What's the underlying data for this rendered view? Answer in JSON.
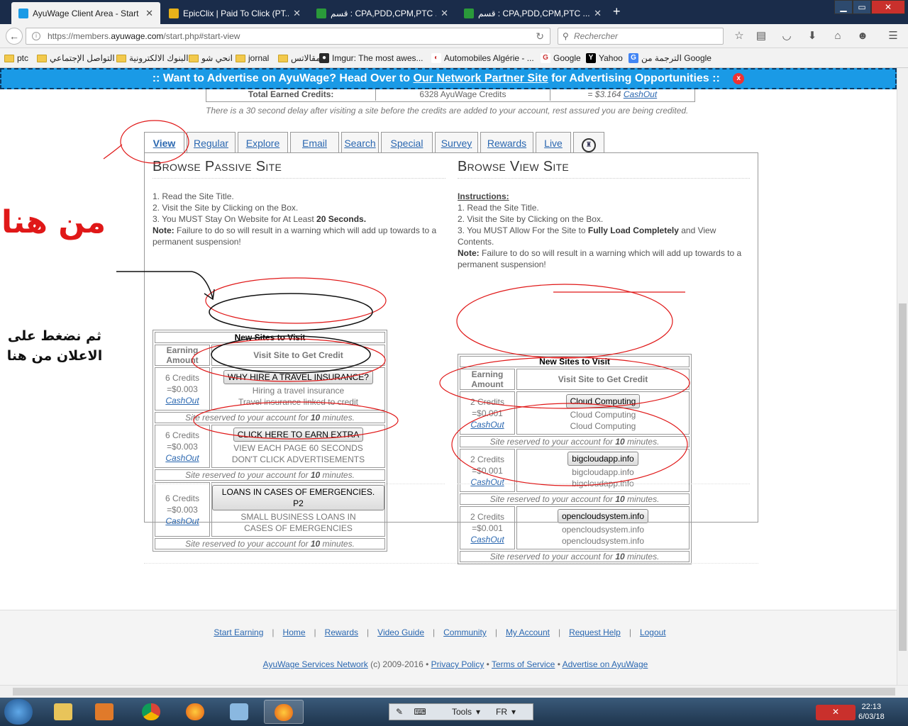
{
  "browser": {
    "tabs": [
      {
        "title": "AyuWage Client Area - Start Ea...",
        "active": true,
        "favicon_color": "#1a9ae6"
      },
      {
        "title": "EpicClix | Paid To Click (PT...",
        "active": false,
        "favicon_color": "#e8b21a"
      },
      {
        "title": "قسم : CPA,PDD,CPM,PTC ....",
        "active": false,
        "favicon_color": "#2a9a3a"
      },
      {
        "title": "قسم : CPA,PDD,CPM,PTC ....",
        "active": false,
        "favicon_color": "#2a9a3a"
      }
    ],
    "new_tab": "+",
    "url_prefix": "https://members.",
    "url_domain": "ayuwage.com",
    "url_path": "/start.php#start-view",
    "search_placeholder": "Rechercher",
    "bookmarks": [
      {
        "label": "ptc",
        "type": "folder"
      },
      {
        "label": "التواصل الإجتماعي",
        "type": "folder"
      },
      {
        "label": "البنوك الالكترونية",
        "type": "folder"
      },
      {
        "label": "انحي شو",
        "type": "folder"
      },
      {
        "label": "jornal",
        "type": "folder"
      },
      {
        "label": "مقالاتس",
        "type": "folder"
      },
      {
        "label": "Imgur: The most awes...",
        "type": "site",
        "color": "#2a2a2a",
        "glyph": "●"
      },
      {
        "label": "Automobiles Algérie - ...",
        "type": "site",
        "color": "#ffffff",
        "glyph": "◐"
      },
      {
        "label": "Google",
        "type": "site",
        "color": "#ffffff",
        "glyph": "G"
      },
      {
        "label": "Yahoo",
        "type": "site",
        "color": "#000000",
        "glyph": "Y"
      },
      {
        "label": "الترجمة من Google",
        "type": "site",
        "color": "#4285f4",
        "glyph": "G"
      }
    ]
  },
  "ad_banner": {
    "before": ":: Want to Advertise on AyuWage? Head Over to ",
    "link": "Our Network Partner Site",
    "after": " for Advertising Opportunities ::",
    "close": "x"
  },
  "credits_row": {
    "label": "Total Earned Credits:",
    "credits": "6328 AyuWage Credits",
    "value_prefix": "= $3.164 ",
    "cashout": "CashOut"
  },
  "delay_note": "There is a 30 second delay after visiting a site before the credits are added to your account, rest assured you are being credited.",
  "tabs": [
    "View",
    "Regular",
    "Explore",
    "Email",
    "Search",
    "Special",
    "Survey",
    "Rewards",
    "Live"
  ],
  "trophy_tab": "♜",
  "passive": {
    "title": "Browse Passive Site",
    "steps": [
      "1. Read the Site Title.",
      "2. Visit the Site by Clicking on the Box.",
      "3. You MUST Stay On Website for At Least "
    ],
    "step3_bold": "20 Seconds.",
    "note_label": "Note:",
    "note_text": " Failure to do so will result in a warning which will add up towards to a permanent suspension!",
    "table_title": "New Sites to Visit",
    "col_earning": "Earning Amount",
    "col_visit": "Visit Site to Get Credit",
    "rows": [
      {
        "credits": "6 Credits",
        "value": "=$0.003",
        "cashout": "CashOut",
        "button": "WHY HIRE A TRAVEL INSURANCE?",
        "line1": "Hiring a travel insurance",
        "line2": "Travel insurance linked to credit",
        "reserved_pre": "Site reserved to your account for ",
        "reserved_min": "10",
        "reserved_post": " minutes."
      },
      {
        "credits": "6 Credits",
        "value": "=$0.003",
        "cashout": "CashOut",
        "button": "CLICK HERE TO EARN EXTRA",
        "line1": "VIEW EACH PAGE 60 SECONDS",
        "line2": "DON'T CLICK ADVERTISEMENTS",
        "reserved_pre": "Site reserved to your account for ",
        "reserved_min": "10",
        "reserved_post": " minutes."
      },
      {
        "credits": "6 Credits",
        "value": "=$0.003",
        "cashout": "CashOut",
        "button": "LOANS IN CASES OF EMERGENCIES. P2",
        "line1": "SMALL BUSINESS LOANS IN",
        "line2": "CASES OF EMERGENCIES",
        "reserved_pre": "Site reserved to your account for ",
        "reserved_min": "10",
        "reserved_post": " minutes."
      }
    ]
  },
  "view": {
    "title": "Browse View Site",
    "instructions_label": "Instructions:",
    "steps": [
      "1. Read the Site Title.",
      "2. Visit the Site by Clicking on the Box.",
      "3. You MUST Allow For the Site to "
    ],
    "step3_bold": "Fully Load Completely",
    "step3_post": "   and View Contents.",
    "note_label": "Note:",
    "note_text": " Failure to do so will result in a warning which will add up towards to a permanent suspension!",
    "table_title": "New Sites to Visit",
    "col_earning": "Earning Amount",
    "col_visit": "Visit Site to Get Credit",
    "rows": [
      {
        "credits": "2 Credits",
        "value": "=$0.001",
        "cashout": "CashOut",
        "button": "Cloud Computing",
        "line1": "Cloud Computing",
        "line2": "Cloud Computing",
        "reserved_pre": "Site reserved to your account for ",
        "reserved_min": "10",
        "reserved_post": " minutes."
      },
      {
        "credits": "2 Credits",
        "value": "=$0.001",
        "cashout": "CashOut",
        "button": "bigcloudapp.info",
        "line1": "bigcloudapp.info",
        "line2": "bigcloudapp.info",
        "reserved_pre": "Site reserved to your account for ",
        "reserved_min": "10",
        "reserved_post": " minutes."
      },
      {
        "credits": "2 Credits",
        "value": "=$0.001",
        "cashout": "CashOut",
        "button": "opencloudsystem.info",
        "line1": "opencloudsystem.info",
        "line2": "opencloudsystem.info",
        "reserved_pre": "Site reserved to your account for ",
        "reserved_min": "10",
        "reserved_post": " minutes."
      }
    ]
  },
  "footer": {
    "nav": [
      "Start Earning",
      "Home",
      "Rewards",
      "Video Guide",
      "Community",
      "My Account",
      "Request Help",
      "Logout"
    ],
    "separator": "|",
    "network": "AyuWage Services Network",
    "copyright": " (c) 2009-2016 • ",
    "privacy": "Privacy Policy",
    "bullet": " • ",
    "terms": "Terms of Service",
    "advertise": "Advertise on AyuWage"
  },
  "annotations": {
    "red_text": "من هنا",
    "black_line1": "ثم نضغط على",
    "black_line2": "الاعلان من هنا",
    "red_color": "#e01818"
  },
  "taskbar": {
    "tools_label": "Tools",
    "lang": "FR",
    "time": "22:13",
    "date": "6/03/18"
  }
}
